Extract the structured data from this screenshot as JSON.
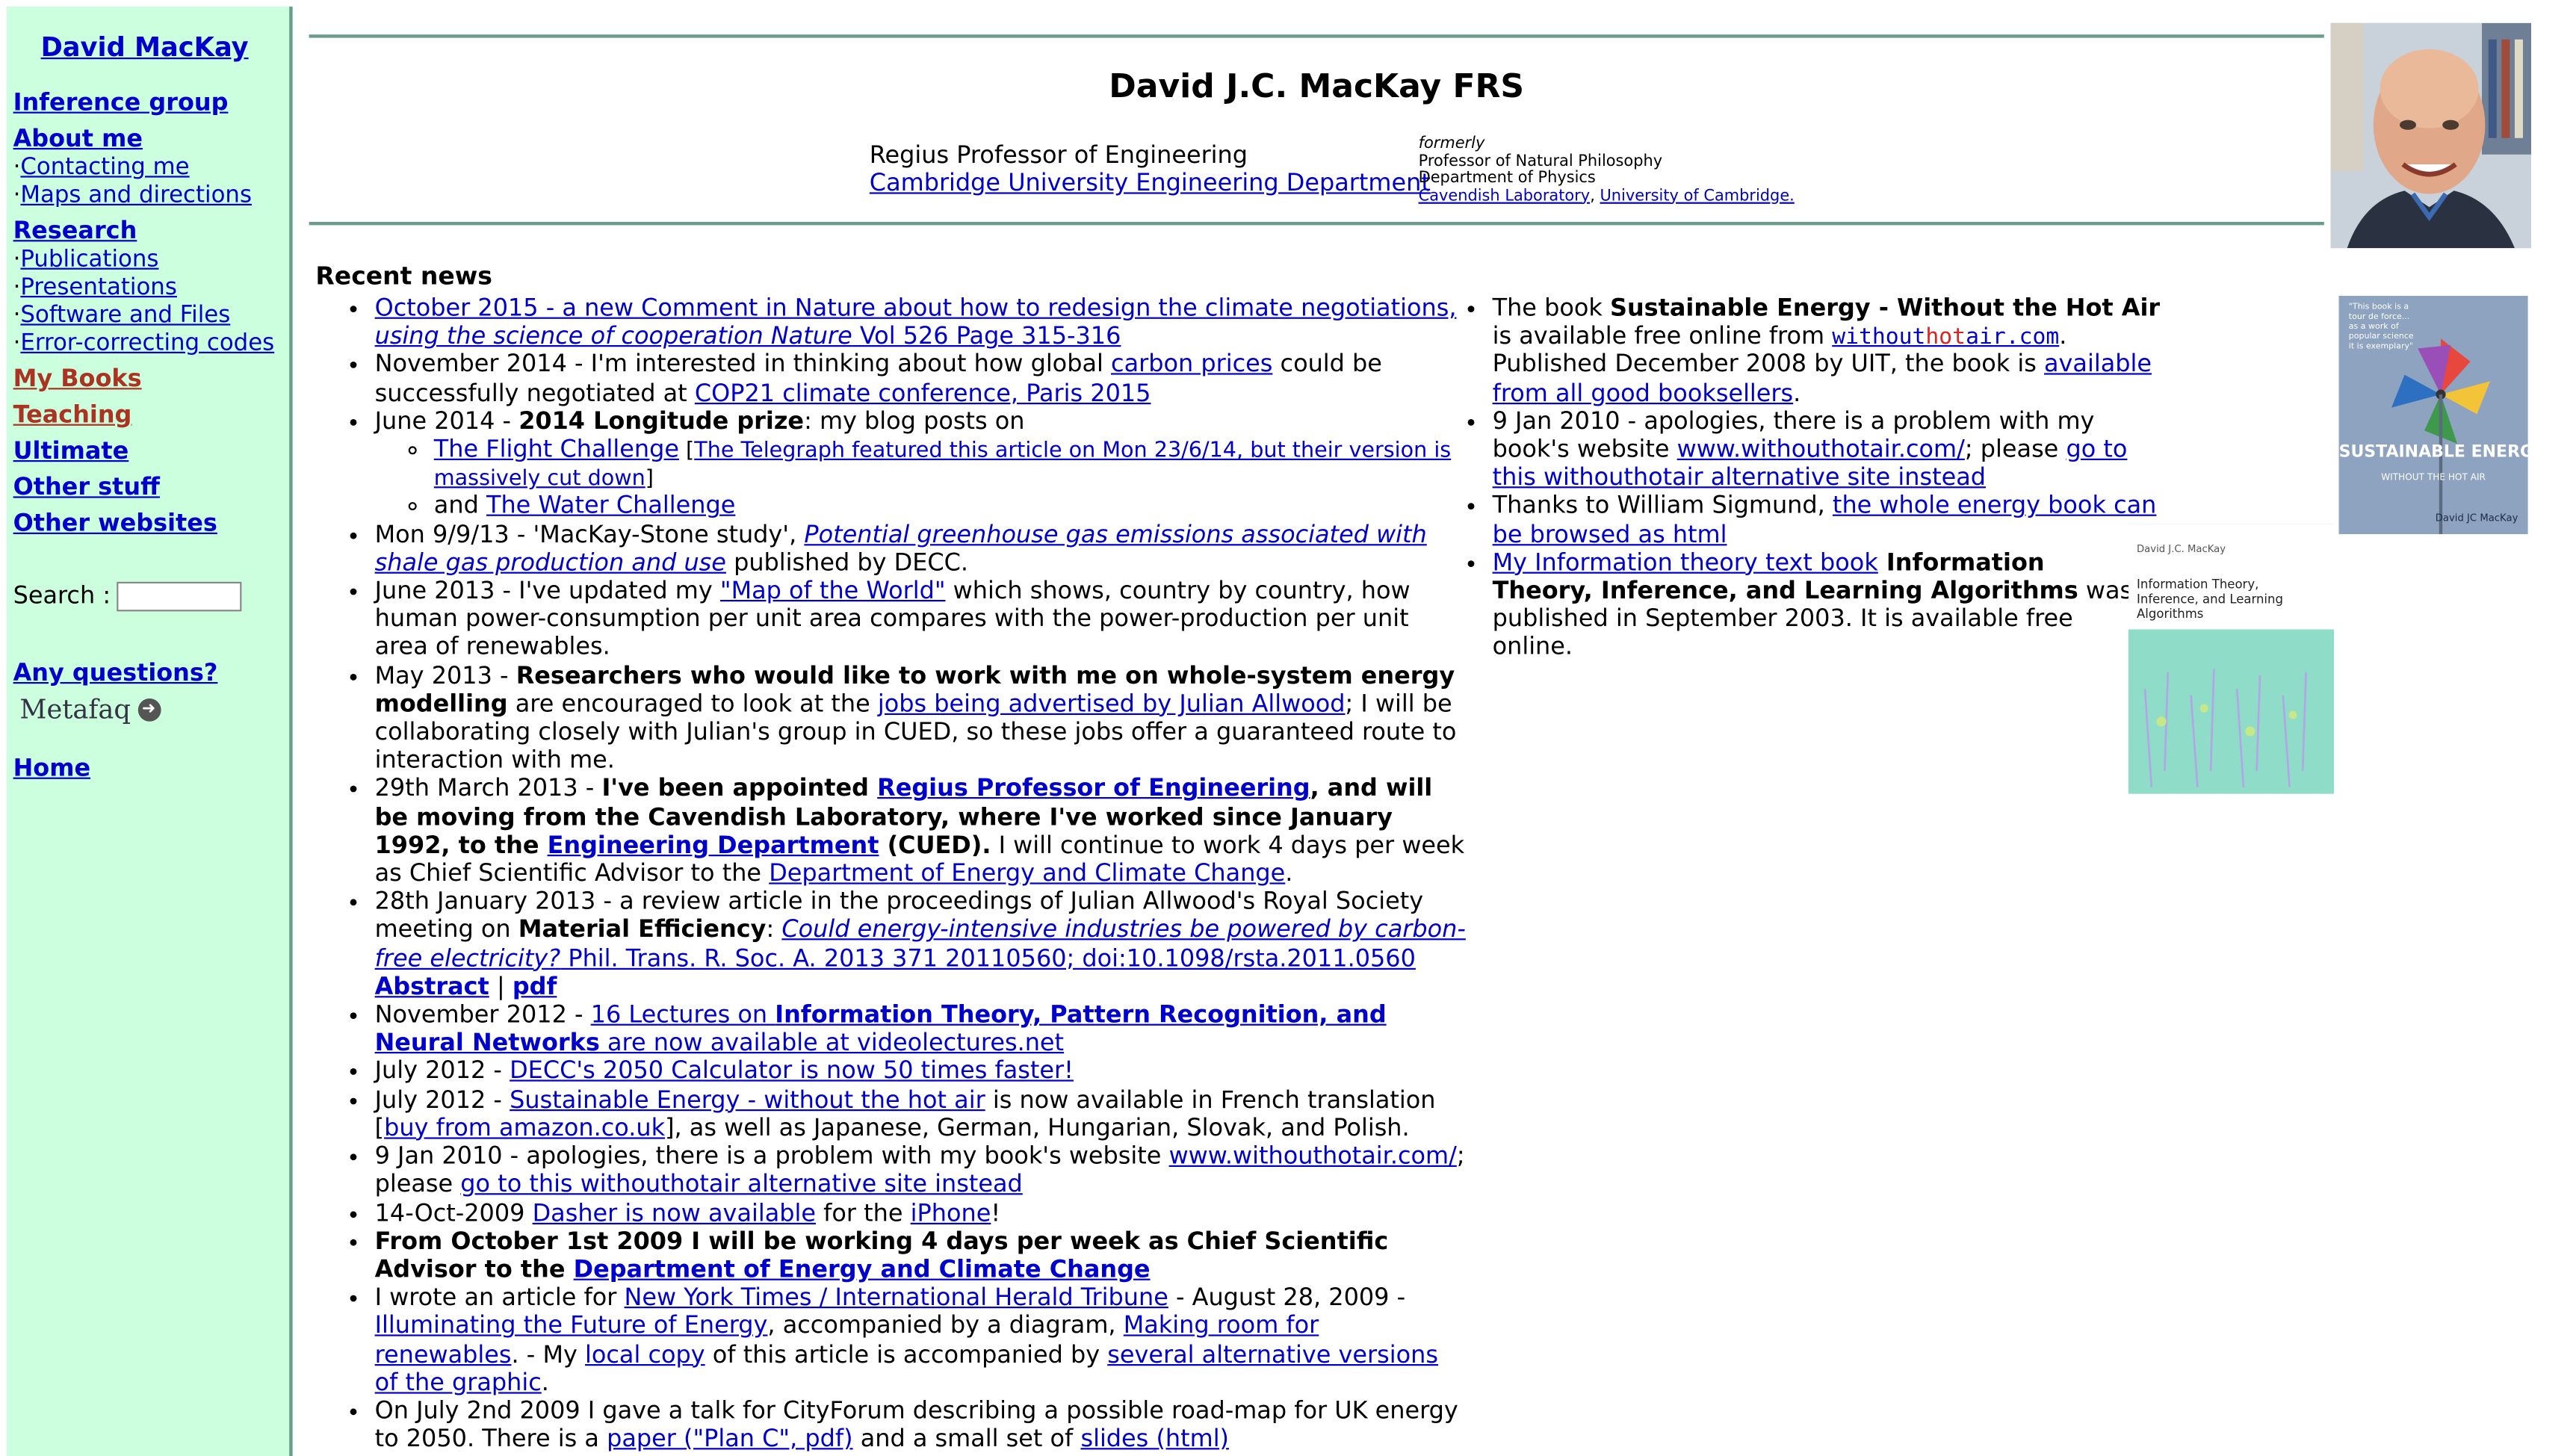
{
  "sidebar": {
    "title": "David MacKay",
    "inference_group": "Inference group",
    "about_me": "About me",
    "contacting_me": "Contacting me",
    "maps_directions": "Maps and directions",
    "research": "Research",
    "publications": "Publications",
    "presentations": "Presentations",
    "software_files": "Software and Files",
    "error_correcting": "Error-correcting codes",
    "my_books": "My Books",
    "teaching": "Teaching",
    "ultimate": "Ultimate",
    "other_stuff": "Other stuff",
    "other_websites": "Other websites",
    "search_label": "Search :",
    "search_value": "",
    "any_questions": "Any questions?",
    "metafaq": "Metafaq",
    "home": "Home",
    "bullet": "·"
  },
  "header": {
    "title": "David J.C. MacKay FRS",
    "role": "Regius Professor of Engineering",
    "department": "Cambridge University Engineering Department",
    "formerly": "formerly",
    "former_role": "Professor of Natural Philosophy",
    "former_dept": "Department of Physics",
    "cavendish": "Cavendish Laboratory",
    "comma": ", ",
    "university": "University of Cambridge."
  },
  "news": {
    "heading": "Recent news",
    "i1_link": "October 2015 - a new Comment in Nature about how to redesign the climate negotiations, ",
    "i1_em": "using the science of cooperation Nature",
    "i1_tail": " Vol 526 Page 315-316",
    "i2_a": "November 2014 - I'm interested in thinking about how global ",
    "i2_link1": "carbon prices",
    "i2_b": " could be successfully negotiated at ",
    "i2_link2": "COP21 climate conference, Paris 2015",
    "i3_a": "June 2014 - ",
    "i3_bold": "2014 Longitude prize",
    "i3_b": ": my blog posts on",
    "i3_flight": "The Flight Challenge",
    "i3_tele_open": " [",
    "i3_telegraph": "The Telegraph featured this article on Mon 23/6/14, but their version is massively cut down",
    "i3_tele_close": "]",
    "i3_and": "and ",
    "i3_water": "The Water Challenge",
    "i4_a": "Mon 9/9/13 - 'MacKay-Stone study', ",
    "i4_link": "Potential greenhouse gas emissions associated with shale gas production and use",
    "i4_b": " published by DECC.",
    "i5_a": "June 2013 - I've updated my ",
    "i5_link": "\"Map of the World\"",
    "i5_b": " which shows, country by country, how human power-consumption per unit area compares with the power-production per unit area of renewables.",
    "i6_a": "May 2013 - ",
    "i6_bold": "Researchers who would like to work with me on whole-system energy modelling",
    "i6_b": " are encouraged to look at the ",
    "i6_link": "jobs being advertised by Julian Allwood",
    "i6_c": "; I will be collaborating closely with Julian's group in CUED, so these jobs offer a guaranteed route to interaction with me.",
    "i7_a": "29th March 2013 - ",
    "i7_bold1": "I've been appointed ",
    "i7_link1": "Regius Professor of Engineering",
    "i7_bold2": ", and will be moving from the Cavendish Laboratory, where I've worked since January 1992, to the ",
    "i7_link2": "Engineering Department",
    "i7_bold3": " (CUED).",
    "i7_b": " I will continue to work 4 days per week as Chief Scientific Advisor to the ",
    "i7_link3": "Department of Energy and Climate Change",
    "i7_c": ".",
    "i8_a": "28th January 2013 - a review article in the proceedings of Julian Allwood's Royal Society meeting on ",
    "i8_bold": "Material Efficiency",
    "i8_b": ": ",
    "i8_em": "Could energy-intensive industries be powered by carbon-free electricity?",
    "i8_tail": " Phil. Trans. R. Soc. A. 2013 371 20110560; doi:10.1098/rsta.2011.0560",
    "i8_abstract": "Abstract",
    "i8_sep": " | ",
    "i8_pdf": "pdf",
    "i9_a": "November 2012 - ",
    "i9_link_a": "16 Lectures on ",
    "i9_link_bold": "Information Theory, Pattern Recognition, and Neural Networks",
    "i9_link_b": " are now available at videolectures.net",
    "i10_a": "July 2012 - ",
    "i10_link": "DECC's 2050 Calculator is now 50 times faster!",
    "i11_a": "July 2012 - ",
    "i11_link": "Sustainable Energy - without the hot air",
    "i11_b": " is now available in French translation [",
    "i11_link2": "buy from amazon.co.uk",
    "i11_c": "], as well as Japanese, German, Hungarian, Slovak, and Polish.",
    "i12_a": "9 Jan 2010 - apologies, there is a problem with my book's website ",
    "i12_link1": "www.withouthotair.com/",
    "i12_b": "; please ",
    "i12_link2": "go to this withouthotair alternative site instead",
    "i13_a": "14-Oct-2009 ",
    "i13_link1": "Dasher is now available",
    "i13_b": " for the ",
    "i13_link2": "iPhone",
    "i13_c": "!",
    "i14_bold": "From October 1st 2009 I will be working 4 days per week as Chief Scientific Advisor to the ",
    "i14_link": "Department of Energy and Climate Change",
    "i15_a": "I wrote an article for ",
    "i15_link1": "New York Times / International Herald Tribune",
    "i15_b": " - August 28, 2009 - ",
    "i15_link2": "Illuminating the Future of Energy",
    "i15_c": ", accompanied by a diagram, ",
    "i15_link3": "Making room for renewables",
    "i15_d": ". - My ",
    "i15_link4": "local copy",
    "i15_e": " of this article is accompanied by ",
    "i15_link5": "several alternative versions of the graphic",
    "i15_f": ".",
    "i16_a": "On July 2nd 2009 I gave a talk for CityForum describing a possible road-map for UK energy to 2050. There is a ",
    "i16_link1": "paper (\"Plan C\", pdf)",
    "i16_b": " and a small set of ",
    "i16_link2": "slides (html)"
  },
  "books": {
    "r1_a": "The book ",
    "r1_bold": "Sustainable Energy - Without the Hot Air",
    "r1_b": " is available free online from ",
    "r1_url_a": "without",
    "r1_url_red": "hot",
    "r1_url_b": "air.com",
    "r1_c": ". Published December 2008 by UIT, the book is ",
    "r1_link": "available from all good booksellers",
    "r1_d": ".",
    "r2_a": "9 Jan 2010 - apologies, there is a problem with my book's website ",
    "r2_link1": "www.withouthotair.com/",
    "r2_b": "; please ",
    "r2_link2": "go to this withouthotair alternative site instead",
    "r3_a": "Thanks to William Sigmund, ",
    "r3_link": "the whole energy book can be browsed as html",
    "r4_link": "My Information theory text book",
    "r4_bold": " Information Theory, Inference, and Learning Algorithms",
    "r4_b": " was published in September 2003. It is available free online.",
    "cover1_line1": "SUSTAINABLE",
    "cover1_line2": "ENERGY–",
    "cover1_sub": "WITHOUT THE HOT AIR",
    "cover1_author": "David JC MacKay",
    "cover1_quote": "\"This book is a tour de force... as a work of popular science it is exemplary\"",
    "cover2_author": "David J.C. MacKay",
    "cover2_title": "Information Theory, Inference, and Learning Algorithms"
  }
}
